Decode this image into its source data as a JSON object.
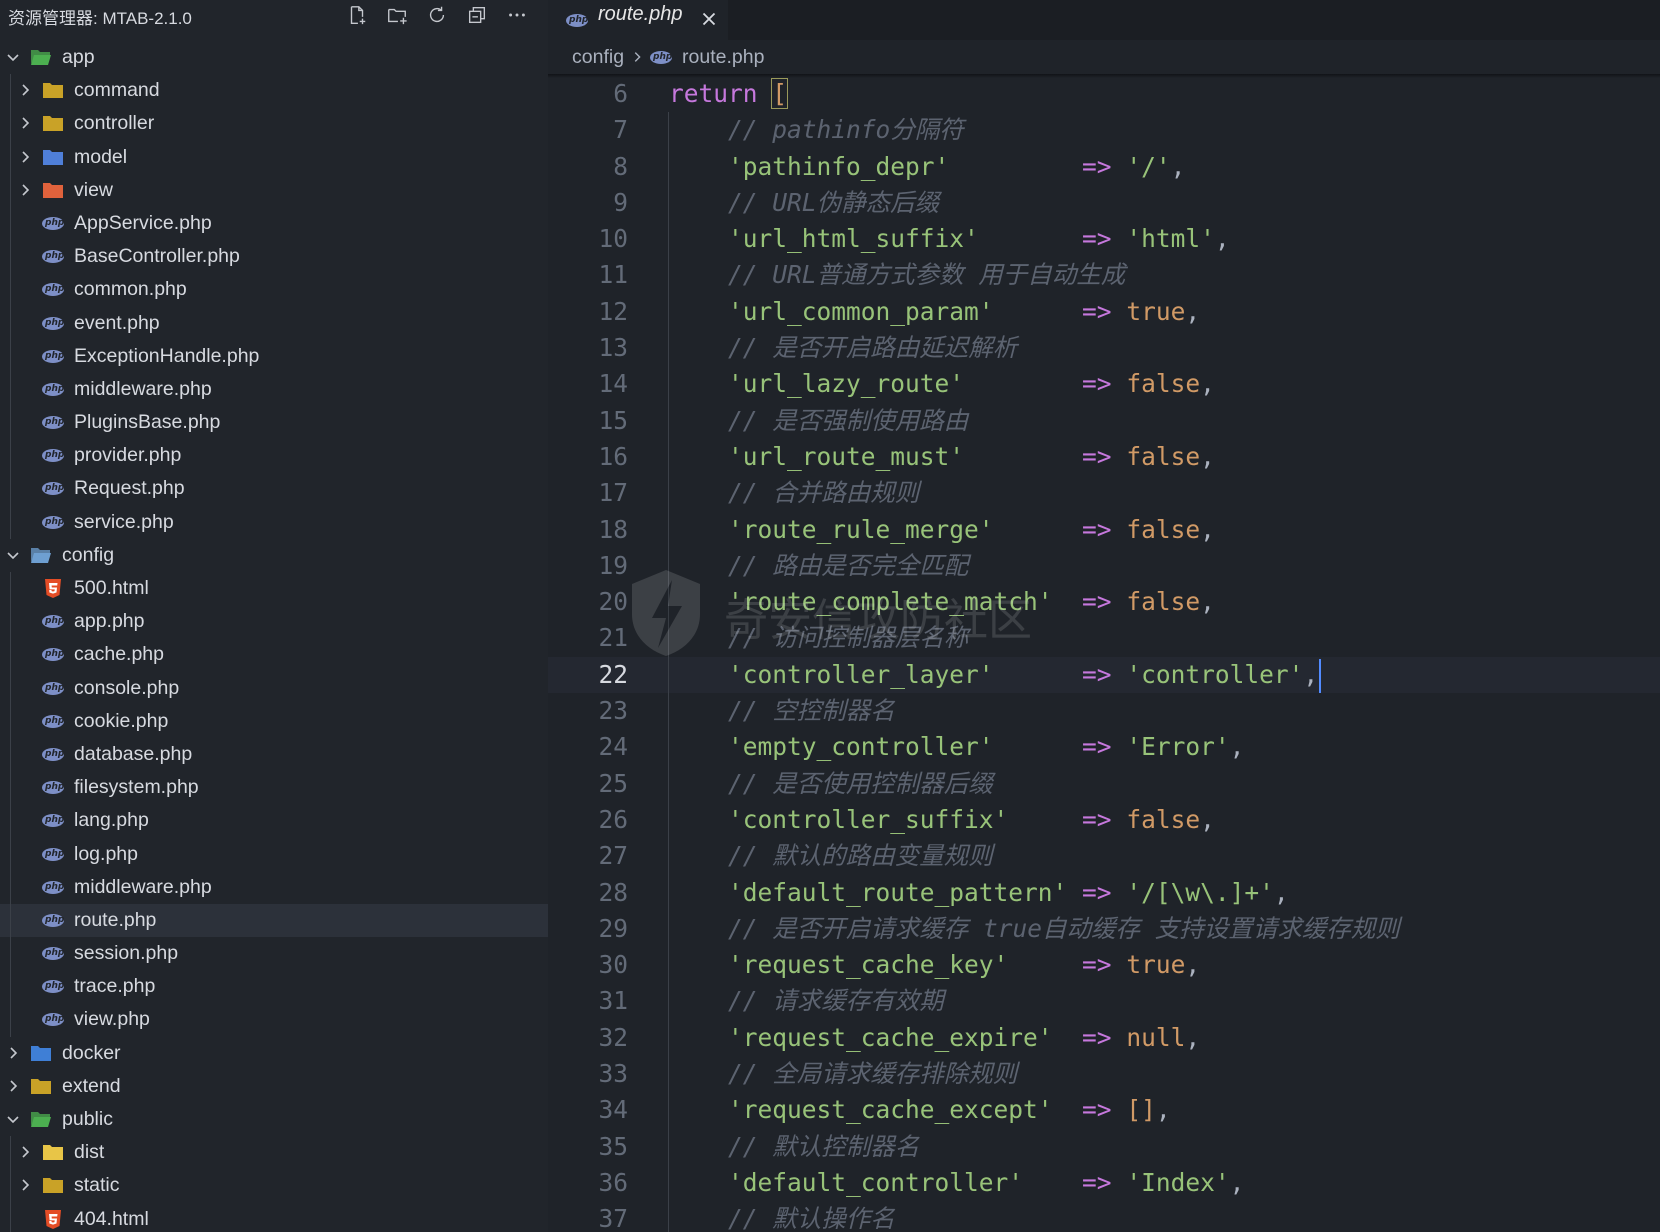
{
  "explorer": {
    "title": "资源管理器: MTAB-2.1.0",
    "actions": [
      {
        "name": "new-file-icon"
      },
      {
        "name": "new-folder-icon"
      },
      {
        "name": "refresh-icon"
      },
      {
        "name": "collapse-all-icon"
      },
      {
        "name": "more-icon"
      }
    ],
    "tree": [
      {
        "label": "app",
        "depth": 0,
        "kind": "folder-open",
        "color": "#4caf50"
      },
      {
        "label": "command",
        "depth": 1,
        "kind": "folder",
        "color": "#c9a227"
      },
      {
        "label": "controller",
        "depth": 1,
        "kind": "folder",
        "color": "#c9a227"
      },
      {
        "label": "model",
        "depth": 1,
        "kind": "folder",
        "color": "#4f7fd9"
      },
      {
        "label": "view",
        "depth": 1,
        "kind": "folder",
        "color": "#e0623c"
      },
      {
        "label": "AppService.php",
        "depth": 1,
        "kind": "php"
      },
      {
        "label": "BaseController.php",
        "depth": 1,
        "kind": "php"
      },
      {
        "label": "common.php",
        "depth": 1,
        "kind": "php"
      },
      {
        "label": "event.php",
        "depth": 1,
        "kind": "php"
      },
      {
        "label": "ExceptionHandle.php",
        "depth": 1,
        "kind": "php"
      },
      {
        "label": "middleware.php",
        "depth": 1,
        "kind": "php"
      },
      {
        "label": "PluginsBase.php",
        "depth": 1,
        "kind": "php"
      },
      {
        "label": "provider.php",
        "depth": 1,
        "kind": "php"
      },
      {
        "label": "Request.php",
        "depth": 1,
        "kind": "php"
      },
      {
        "label": "service.php",
        "depth": 1,
        "kind": "php"
      },
      {
        "label": "config",
        "depth": 0,
        "kind": "folder-open",
        "color": "#6e9fd1"
      },
      {
        "label": "500.html",
        "depth": 1,
        "kind": "html"
      },
      {
        "label": "app.php",
        "depth": 1,
        "kind": "php"
      },
      {
        "label": "cache.php",
        "depth": 1,
        "kind": "php"
      },
      {
        "label": "console.php",
        "depth": 1,
        "kind": "php"
      },
      {
        "label": "cookie.php",
        "depth": 1,
        "kind": "php"
      },
      {
        "label": "database.php",
        "depth": 1,
        "kind": "php"
      },
      {
        "label": "filesystem.php",
        "depth": 1,
        "kind": "php"
      },
      {
        "label": "lang.php",
        "depth": 1,
        "kind": "php"
      },
      {
        "label": "log.php",
        "depth": 1,
        "kind": "php"
      },
      {
        "label": "middleware.php",
        "depth": 1,
        "kind": "php"
      },
      {
        "label": "route.php",
        "depth": 1,
        "kind": "php",
        "selected": true
      },
      {
        "label": "session.php",
        "depth": 1,
        "kind": "php"
      },
      {
        "label": "trace.php",
        "depth": 1,
        "kind": "php"
      },
      {
        "label": "view.php",
        "depth": 1,
        "kind": "php"
      },
      {
        "label": "docker",
        "depth": 0,
        "kind": "folder",
        "color": "#3f7fd6"
      },
      {
        "label": "extend",
        "depth": 0,
        "kind": "folder",
        "color": "#c9a227"
      },
      {
        "label": "public",
        "depth": 0,
        "kind": "folder-open",
        "color": "#4caf50"
      },
      {
        "label": "dist",
        "depth": 1,
        "kind": "folder",
        "color": "#e8c547"
      },
      {
        "label": "static",
        "depth": 1,
        "kind": "folder",
        "color": "#c9a227"
      },
      {
        "label": "404.html",
        "depth": 1,
        "kind": "html"
      }
    ]
  },
  "tab": {
    "label": "route.php"
  },
  "breadcrumb": {
    "folder": "config",
    "file": "route.php"
  },
  "editor": {
    "current_line": 22,
    "lines": [
      {
        "n": "6",
        "tokens": [
          [
            "kw",
            "return"
          ],
          [
            "pun",
            " "
          ],
          [
            "br",
            "["
          ]
        ]
      },
      {
        "n": "7",
        "indent": true,
        "tokens": [
          [
            "com",
            "    // pathinfo分隔符"
          ]
        ]
      },
      {
        "n": "8",
        "indent": true,
        "tokens": [
          [
            "str",
            "    'pathinfo_depr'"
          ],
          [
            "pun",
            "         "
          ],
          [
            "op",
            "=>"
          ],
          [
            "pun",
            " "
          ],
          [
            "str",
            "'/'"
          ],
          [
            "pun",
            ","
          ]
        ]
      },
      {
        "n": "9",
        "indent": true,
        "tokens": [
          [
            "com",
            "    // URL伪静态后缀"
          ]
        ]
      },
      {
        "n": "10",
        "indent": true,
        "tokens": [
          [
            "str",
            "    'url_html_suffix'"
          ],
          [
            "pun",
            "       "
          ],
          [
            "op",
            "=>"
          ],
          [
            "pun",
            " "
          ],
          [
            "str",
            "'html'"
          ],
          [
            "pun",
            ","
          ]
        ]
      },
      {
        "n": "11",
        "indent": true,
        "tokens": [
          [
            "com",
            "    // URL普通方式参数 用于自动生成"
          ]
        ]
      },
      {
        "n": "12",
        "indent": true,
        "tokens": [
          [
            "str",
            "    'url_common_param'"
          ],
          [
            "pun",
            "      "
          ],
          [
            "op",
            "=>"
          ],
          [
            "pun",
            " "
          ],
          [
            "con",
            "true"
          ],
          [
            "pun",
            ","
          ]
        ]
      },
      {
        "n": "13",
        "indent": true,
        "tokens": [
          [
            "com",
            "    // 是否开启路由延迟解析"
          ]
        ]
      },
      {
        "n": "14",
        "indent": true,
        "tokens": [
          [
            "str",
            "    'url_lazy_route'"
          ],
          [
            "pun",
            "        "
          ],
          [
            "op",
            "=>"
          ],
          [
            "pun",
            " "
          ],
          [
            "con",
            "false"
          ],
          [
            "pun",
            ","
          ]
        ]
      },
      {
        "n": "15",
        "indent": true,
        "tokens": [
          [
            "com",
            "    // 是否强制使用路由"
          ]
        ]
      },
      {
        "n": "16",
        "indent": true,
        "tokens": [
          [
            "str",
            "    'url_route_must'"
          ],
          [
            "pun",
            "        "
          ],
          [
            "op",
            "=>"
          ],
          [
            "pun",
            " "
          ],
          [
            "con",
            "false"
          ],
          [
            "pun",
            ","
          ]
        ]
      },
      {
        "n": "17",
        "indent": true,
        "tokens": [
          [
            "com",
            "    // 合并路由规则"
          ]
        ]
      },
      {
        "n": "18",
        "indent": true,
        "tokens": [
          [
            "str",
            "    'route_rule_merge'"
          ],
          [
            "pun",
            "      "
          ],
          [
            "op",
            "=>"
          ],
          [
            "pun",
            " "
          ],
          [
            "con",
            "false"
          ],
          [
            "pun",
            ","
          ]
        ]
      },
      {
        "n": "19",
        "indent": true,
        "tokens": [
          [
            "com",
            "    // 路由是否完全匹配"
          ]
        ]
      },
      {
        "n": "20",
        "indent": true,
        "tokens": [
          [
            "str",
            "    'route_complete_match'"
          ],
          [
            "pun",
            "  "
          ],
          [
            "op",
            "=>"
          ],
          [
            "pun",
            " "
          ],
          [
            "con",
            "false"
          ],
          [
            "pun",
            ","
          ]
        ]
      },
      {
        "n": "21",
        "indent": true,
        "tokens": [
          [
            "com",
            "    // 访问控制器层名称"
          ]
        ]
      },
      {
        "n": "22",
        "indent": true,
        "cursor": true,
        "tokens": [
          [
            "str",
            "    'controller_layer'"
          ],
          [
            "pun",
            "      "
          ],
          [
            "op",
            "=>"
          ],
          [
            "pun",
            " "
          ],
          [
            "str",
            "'controller'"
          ],
          [
            "pun",
            ","
          ]
        ]
      },
      {
        "n": "23",
        "indent": true,
        "tokens": [
          [
            "com",
            "    // 空控制器名"
          ]
        ]
      },
      {
        "n": "24",
        "indent": true,
        "tokens": [
          [
            "str",
            "    'empty_controller'"
          ],
          [
            "pun",
            "      "
          ],
          [
            "op",
            "=>"
          ],
          [
            "pun",
            " "
          ],
          [
            "str",
            "'Error'"
          ],
          [
            "pun",
            ","
          ]
        ]
      },
      {
        "n": "25",
        "indent": true,
        "tokens": [
          [
            "com",
            "    // 是否使用控制器后缀"
          ]
        ]
      },
      {
        "n": "26",
        "indent": true,
        "tokens": [
          [
            "str",
            "    'controller_suffix'"
          ],
          [
            "pun",
            "     "
          ],
          [
            "op",
            "=>"
          ],
          [
            "pun",
            " "
          ],
          [
            "con",
            "false"
          ],
          [
            "pun",
            ","
          ]
        ]
      },
      {
        "n": "27",
        "indent": true,
        "tokens": [
          [
            "com",
            "    // 默认的路由变量规则"
          ]
        ]
      },
      {
        "n": "28",
        "indent": true,
        "tokens": [
          [
            "str",
            "    'default_route_pattern'"
          ],
          [
            "pun",
            " "
          ],
          [
            "op",
            "=>"
          ],
          [
            "pun",
            " "
          ],
          [
            "str",
            "'/[\\w\\.]+'"
          ],
          [
            "pun",
            ","
          ]
        ]
      },
      {
        "n": "29",
        "indent": true,
        "tokens": [
          [
            "com",
            "    // 是否开启请求缓存 true自动缓存 支持设置请求缓存规则"
          ]
        ]
      },
      {
        "n": "30",
        "indent": true,
        "tokens": [
          [
            "str",
            "    'request_cache_key'"
          ],
          [
            "pun",
            "     "
          ],
          [
            "op",
            "=>"
          ],
          [
            "pun",
            " "
          ],
          [
            "con",
            "true"
          ],
          [
            "pun",
            ","
          ]
        ]
      },
      {
        "n": "31",
        "indent": true,
        "tokens": [
          [
            "com",
            "    // 请求缓存有效期"
          ]
        ]
      },
      {
        "n": "32",
        "indent": true,
        "tokens": [
          [
            "str",
            "    'request_cache_expire'"
          ],
          [
            "pun",
            "  "
          ],
          [
            "op",
            "=>"
          ],
          [
            "pun",
            " "
          ],
          [
            "con",
            "null"
          ],
          [
            "pun",
            ","
          ]
        ]
      },
      {
        "n": "33",
        "indent": true,
        "tokens": [
          [
            "com",
            "    // 全局请求缓存排除规则"
          ]
        ]
      },
      {
        "n": "34",
        "indent": true,
        "tokens": [
          [
            "str",
            "    'request_cache_except'"
          ],
          [
            "pun",
            "  "
          ],
          [
            "op",
            "=>"
          ],
          [
            "pun",
            " "
          ],
          [
            "con",
            "[]"
          ],
          [
            "pun",
            ","
          ]
        ]
      },
      {
        "n": "35",
        "indent": true,
        "tokens": [
          [
            "com",
            "    // 默认控制器名"
          ]
        ]
      },
      {
        "n": "36",
        "indent": true,
        "tokens": [
          [
            "str",
            "    'default_controller'"
          ],
          [
            "pun",
            "    "
          ],
          [
            "op",
            "=>"
          ],
          [
            "pun",
            " "
          ],
          [
            "str",
            "'Index'"
          ],
          [
            "pun",
            ","
          ]
        ]
      },
      {
        "n": "37",
        "indent": true,
        "tokens": [
          [
            "com",
            "    // 默认操作名"
          ]
        ]
      }
    ]
  },
  "watermark": {
    "text": "奇安信攻防社区"
  },
  "colors": {
    "sidebar_bg": "#21252b",
    "editor_bg": "#1f2329",
    "cursor": "#528bff",
    "keyword": "#c678dd",
    "string": "#98c379",
    "constant": "#d19a66",
    "comment": "#5c6370"
  }
}
